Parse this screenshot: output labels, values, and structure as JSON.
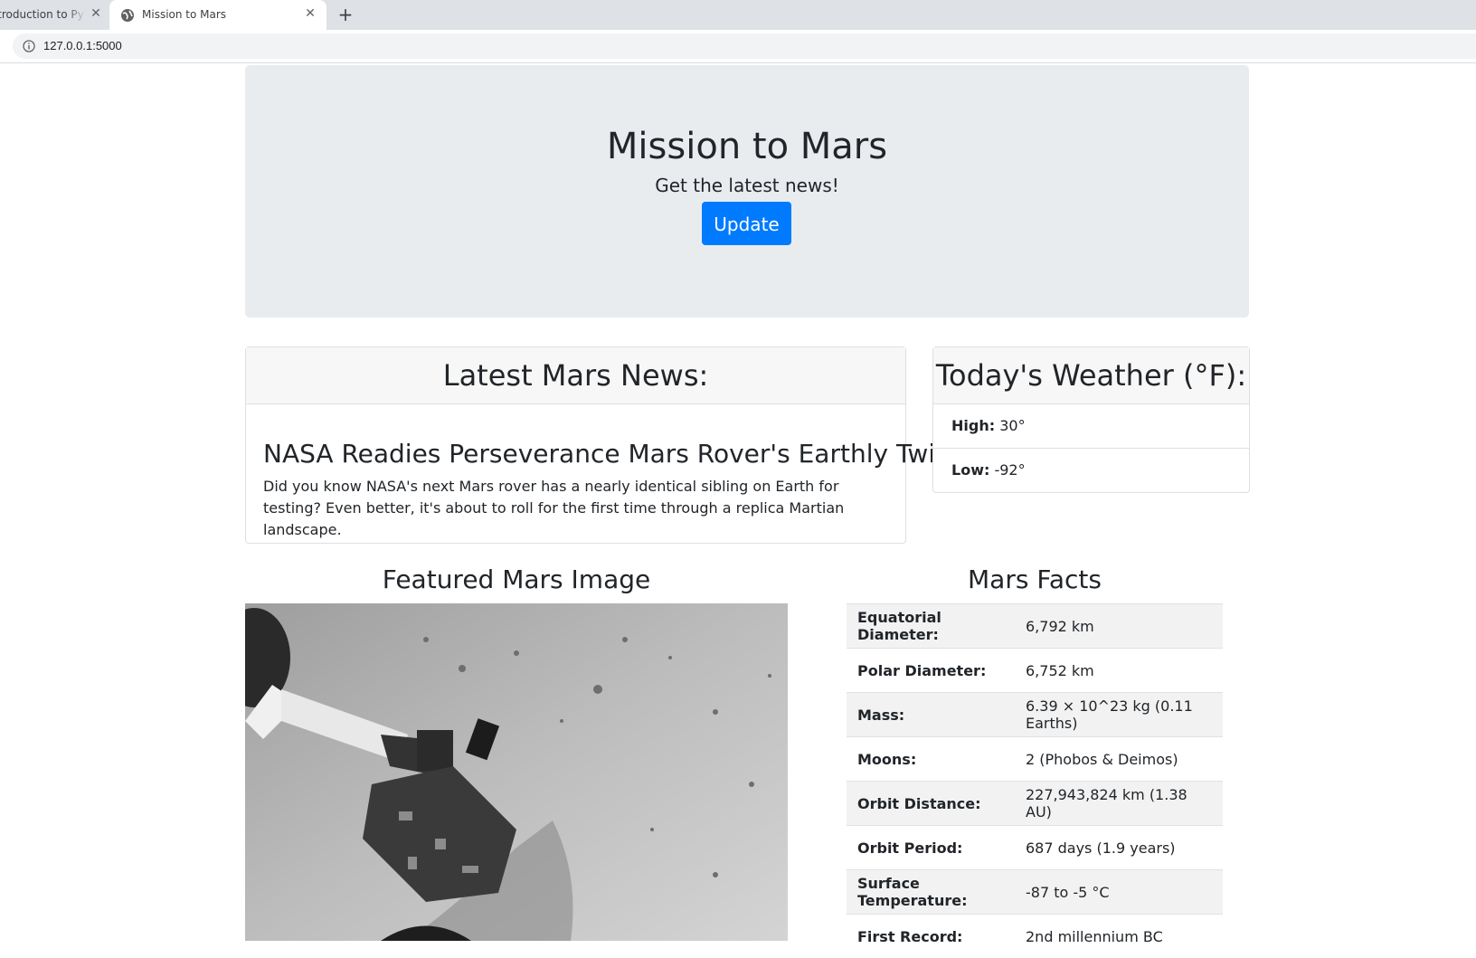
{
  "browser": {
    "tabs": [
      {
        "title": "Introduction to Python",
        "close": "✕"
      },
      {
        "title": "Mission to Mars",
        "close": "✕"
      }
    ],
    "new_tab": "+",
    "url": "127.0.0.1:5000"
  },
  "jumbotron": {
    "title": "Mission to Mars",
    "lead": "Get the latest news!",
    "button": "Update"
  },
  "news": {
    "header": "Latest Mars News:",
    "title": "NASA Readies Perseverance Mars Rover's Earthly Twin",
    "body": "Did you know NASA's next Mars rover has a nearly identical sibling on Earth for testing? Even better, it's about to roll for the first time through a replica Martian landscape."
  },
  "weather": {
    "header": "Today's Weather (°F):",
    "high_label": "High:",
    "high_value": "30°",
    "low_label": "Low:",
    "low_value": "-92°"
  },
  "featured": {
    "heading": "Featured Mars Image"
  },
  "facts": {
    "heading": "Mars Facts",
    "rows": [
      {
        "k": "Equatorial Diameter:",
        "v": "6,792 km"
      },
      {
        "k": "Polar Diameter:",
        "v": "6,752 km"
      },
      {
        "k": "Mass:",
        "v": "6.39 × 10^23 kg (0.11 Earths)"
      },
      {
        "k": "Moons:",
        "v": "2 (Phobos & Deimos)"
      },
      {
        "k": "Orbit Distance:",
        "v": "227,943,824 km (1.38 AU)"
      },
      {
        "k": "Orbit Period:",
        "v": "687 days (1.9 years)"
      },
      {
        "k": "Surface Temperature:",
        "v": "-87 to -5 °C"
      },
      {
        "k": "First Record:",
        "v": "2nd millennium BC"
      }
    ]
  },
  "colors": {
    "accent": "#007bff",
    "jumbotron_bg": "#e9ecef",
    "tabstrip_bg": "#dee1e6"
  }
}
